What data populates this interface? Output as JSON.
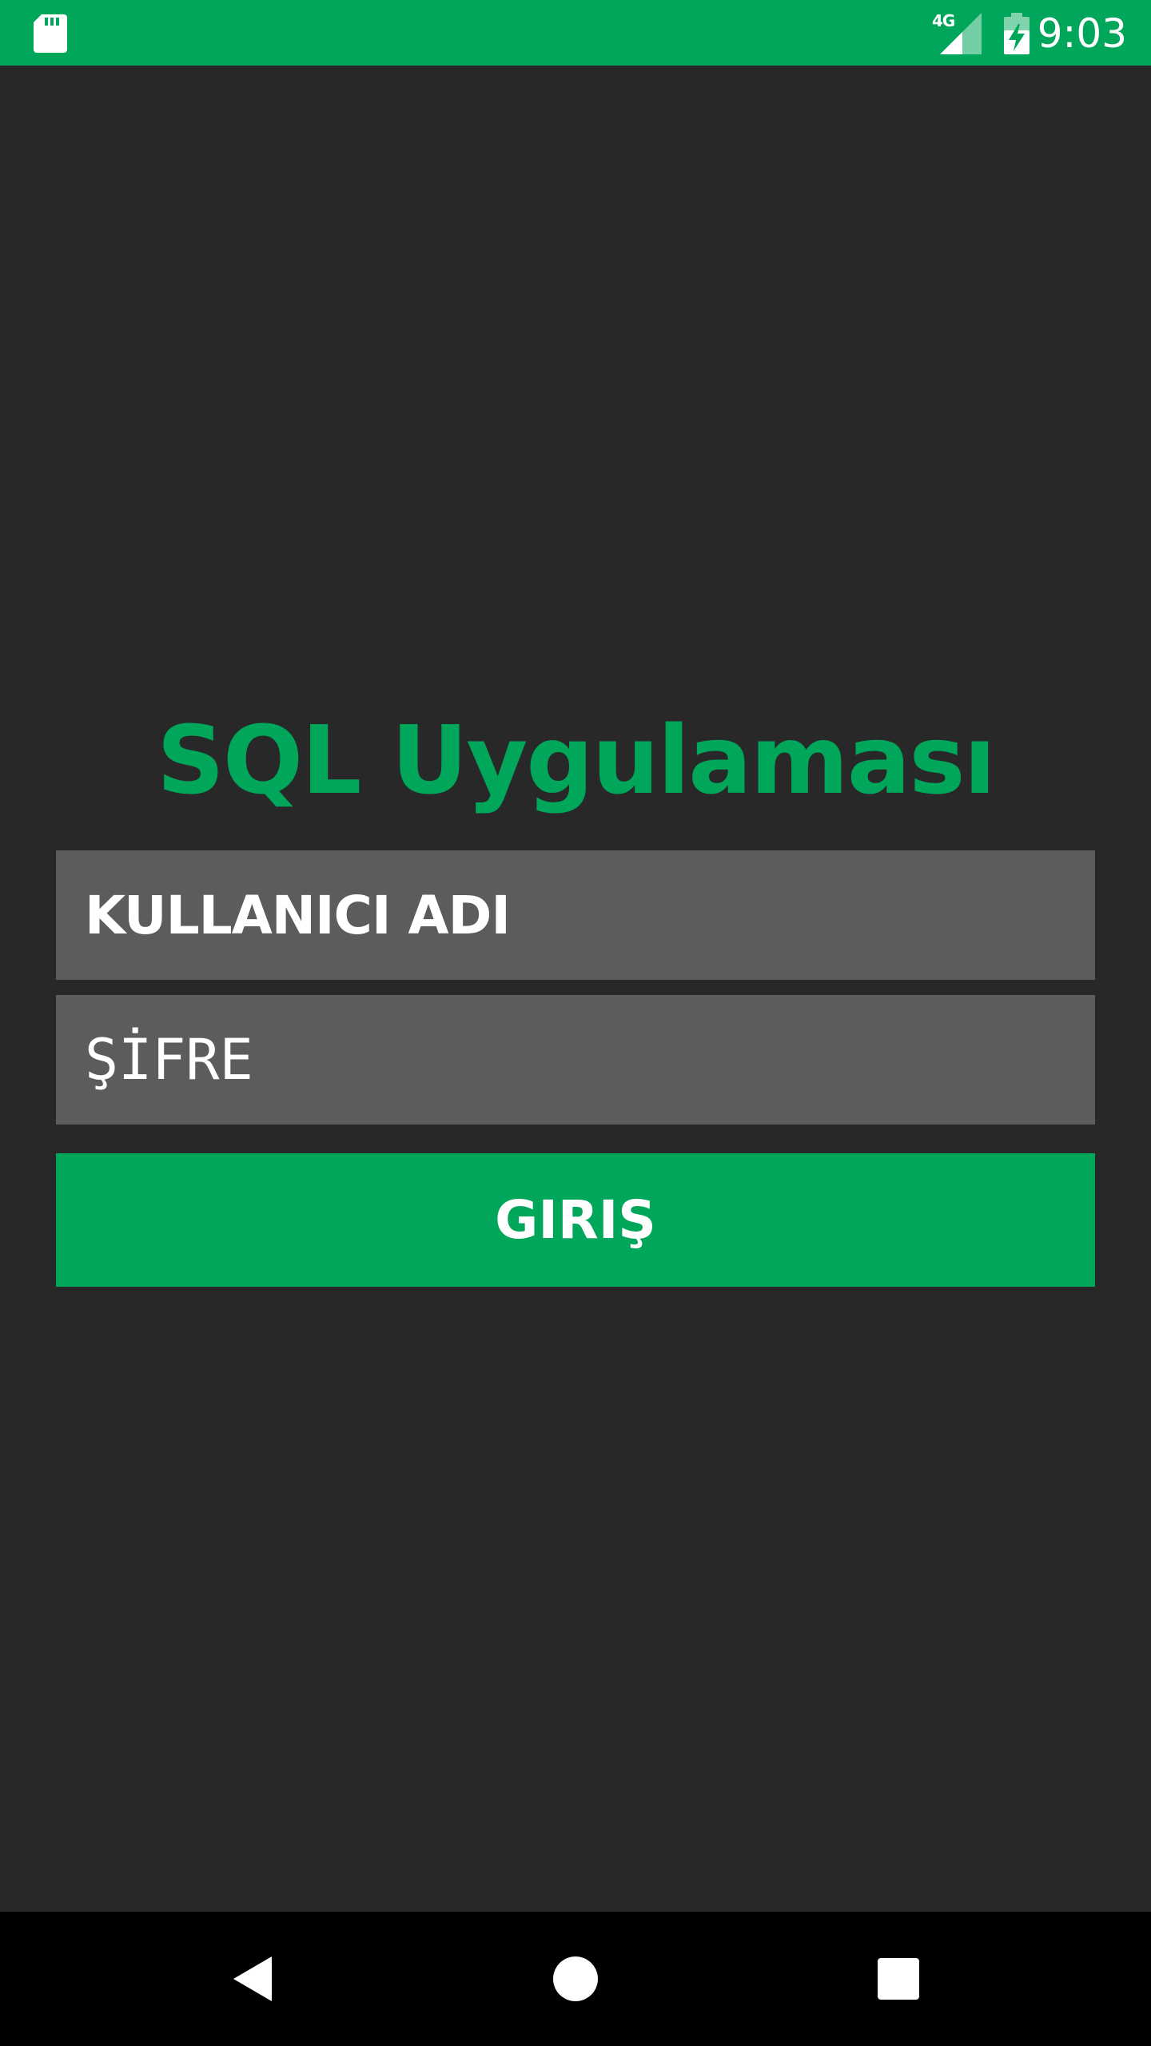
{
  "status_bar": {
    "network_type": "4G",
    "time": "9:03",
    "left_icon": "sd-card-icon",
    "signal_icon": "signal-icon",
    "battery_icon": "battery-charging-icon",
    "color": "#00a65a"
  },
  "app": {
    "title": "SQL Uygulaması",
    "accent_color": "#00a65a",
    "background_color": "#282828"
  },
  "form": {
    "username_value": "KULLANICI ADI",
    "password_value": "ŞİFRE",
    "field_background": "#5c5c5c",
    "login_label": "GIRIŞ"
  },
  "nav_bar": {
    "back_icon": "back-triangle-icon",
    "home_icon": "home-circle-icon",
    "recents_icon": "recents-square-icon"
  }
}
